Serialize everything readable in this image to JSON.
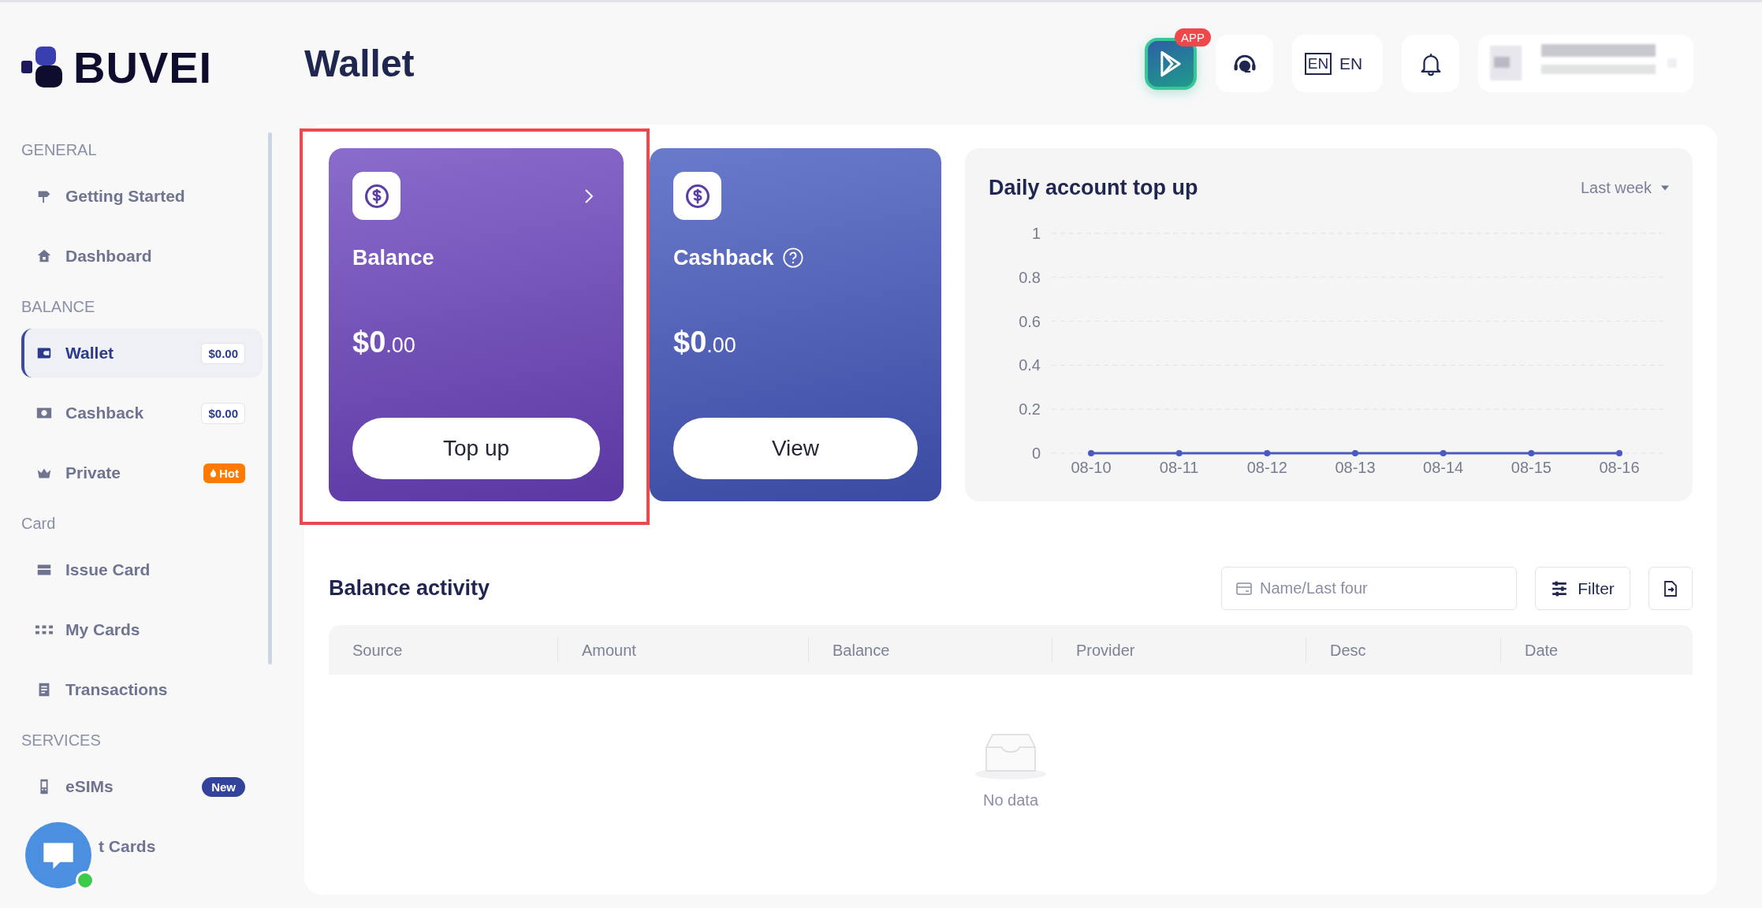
{
  "logo": {
    "text": "BUVEI"
  },
  "sidebar": {
    "sections": [
      {
        "title": "GENERAL",
        "items": [
          {
            "label": "Getting Started",
            "selected": false
          },
          {
            "label": "Dashboard",
            "selected": false
          }
        ]
      },
      {
        "title": "BALANCE",
        "items": [
          {
            "label": "Wallet",
            "selected": true,
            "badge": {
              "kind": "amount",
              "text": "$0.00"
            }
          },
          {
            "label": "Cashback",
            "selected": false,
            "badge": {
              "kind": "amount",
              "text": "$0.00"
            }
          },
          {
            "label": "Private",
            "selected": false,
            "badge": {
              "kind": "hot",
              "text": "Hot"
            }
          }
        ]
      },
      {
        "title": "Card",
        "items": [
          {
            "label": "Issue Card",
            "selected": false
          },
          {
            "label": "My Cards",
            "selected": false
          },
          {
            "label": "Transactions",
            "selected": false
          }
        ]
      },
      {
        "title": "SERVICES",
        "items": [
          {
            "label": "eSIMs",
            "selected": false,
            "badge": {
              "kind": "new",
              "text": "New"
            }
          },
          {
            "label": "t Cards",
            "selected": false
          }
        ]
      }
    ]
  },
  "chat_widget": {
    "online": true
  },
  "page_title": "Wallet",
  "header": {
    "app_badge": "APP",
    "language": {
      "icon_text": "EN",
      "label": "EN"
    }
  },
  "cards": [
    {
      "kind": "balance",
      "title": "Balance",
      "amount_main": "$0",
      "amount_cents": ".00",
      "button": "Top up",
      "has_arrow": true,
      "has_help": false,
      "highlighted": true
    },
    {
      "kind": "cashback",
      "title": "Cashback",
      "amount_main": "$0",
      "amount_cents": ".00",
      "button": "View",
      "has_arrow": false,
      "has_help": true,
      "highlighted": false
    }
  ],
  "top_up_chart": {
    "title": "Daily account top up",
    "period": "Last week",
    "chart_data": {
      "type": "line",
      "categories": [
        "08-10",
        "08-11",
        "08-12",
        "08-13",
        "08-14",
        "08-15",
        "08-16"
      ],
      "grid": true,
      "series": [
        {
          "color": "#4a5bbf",
          "marker": true,
          "values": [
            0,
            0,
            0,
            0,
            0,
            0,
            0
          ]
        }
      ],
      "ylim": [
        0,
        1
      ],
      "yticks": [
        0,
        0.2,
        0.4,
        0.6,
        0.8,
        1
      ]
    }
  },
  "activity": {
    "title": "Balance activity",
    "search": {
      "placeholder": "Name/Last four"
    },
    "filter_button": "Filter",
    "table": {
      "columns": [
        "Source",
        "Amount",
        "Balance",
        "Provider",
        "Desc",
        "Date"
      ],
      "empty_text": "No data"
    }
  }
}
